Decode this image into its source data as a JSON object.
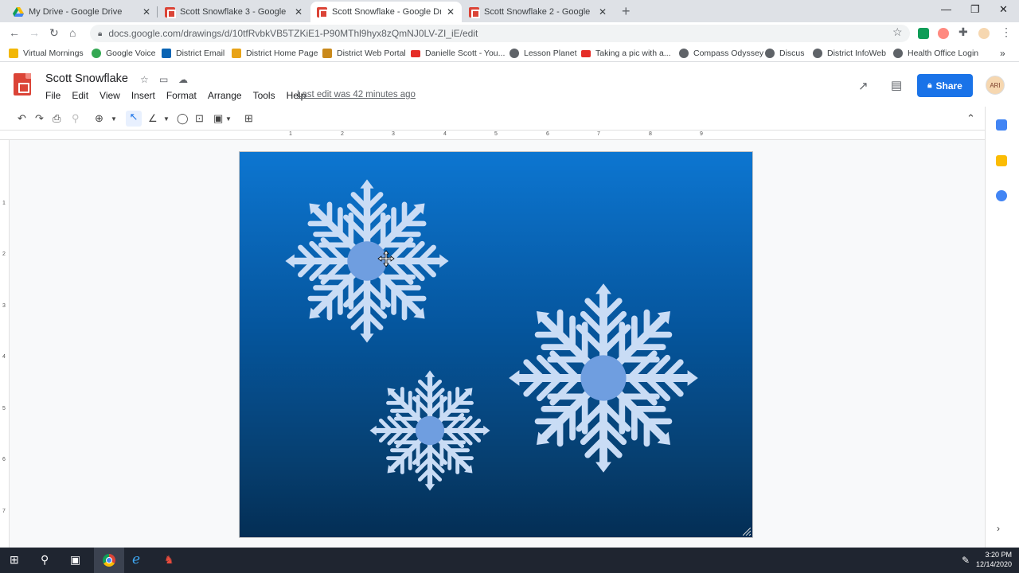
{
  "browser": {
    "tabs": [
      {
        "title": "My Drive - Google Drive",
        "favicon": "google-drive-icon"
      },
      {
        "title": "Scott Snowflake 3 - Google Drawings",
        "favicon": "google-drawings-icon"
      },
      {
        "title": "Scott Snowflake - Google Drawings",
        "favicon": "google-drawings-icon"
      },
      {
        "title": "Scott Snowflake 2 - Google Drawings",
        "favicon": "google-drawings-icon"
      }
    ],
    "active_tab": 2,
    "url": "docs.google.com/drawings/d/10tfRvbkVB5TZKiE1-P90MThl9hyx8zQmNJ0LV-ZI_iE/edit",
    "bookmarks": [
      {
        "label": "Virtual Mornings",
        "icon": "folder-icon",
        "color": "#f2b705"
      },
      {
        "label": "Google Voice",
        "icon": "google-voice-icon",
        "color": "#34a853"
      },
      {
        "label": "District Email",
        "icon": "outlook-icon",
        "color": "#0a64b4"
      },
      {
        "label": "District Home Page",
        "icon": "school-icon",
        "color": "#e8a317"
      },
      {
        "label": "District Web Portal",
        "icon": "portal-icon",
        "color": "#c9891b"
      },
      {
        "label": "Danielle Scott - You...",
        "icon": "youtube-icon",
        "color": "#e52d27"
      },
      {
        "label": "Lesson Planet",
        "icon": "globe-icon",
        "color": "#5f6368"
      },
      {
        "label": "Taking a pic with a...",
        "icon": "youtube-icon",
        "color": "#e52d27"
      },
      {
        "label": "Compass Odyssey",
        "icon": "globe-icon",
        "color": "#5f6368"
      },
      {
        "label": "Discus",
        "icon": "globe-icon",
        "color": "#5f6368"
      },
      {
        "label": "District InfoWeb",
        "icon": "globe-icon",
        "color": "#5f6368"
      },
      {
        "label": "Health Office Login",
        "icon": "globe-icon",
        "color": "#5f6368"
      }
    ]
  },
  "app": {
    "title": "Scott Snowflake",
    "menu": [
      "File",
      "Edit",
      "View",
      "Insert",
      "Format",
      "Arrange",
      "Tools",
      "Help"
    ],
    "last_edit": "Last edit was 42 minutes ago",
    "share_label": "Share",
    "avatar_text": "ARI"
  },
  "ruler": {
    "horizontal": [
      "1",
      "2",
      "3",
      "4",
      "5",
      "6",
      "7",
      "8",
      "9"
    ],
    "vertical": [
      "1",
      "2",
      "3",
      "4",
      "5",
      "6",
      "7"
    ]
  },
  "canvas": {
    "background_top": "#0d76d1",
    "background_bottom": "#042e55",
    "snowflake_color": "#c9dcf5",
    "snowflake_center_color": "#6f9ee0",
    "snowflakes": [
      "snowflake-small",
      "snowflake-medium",
      "snowflake-large"
    ]
  },
  "taskbar": {
    "time": "3:20 PM",
    "date": "12/14/2020"
  },
  "colors": {
    "accent": "#1a73e8",
    "drawings_red": "#db4437"
  }
}
